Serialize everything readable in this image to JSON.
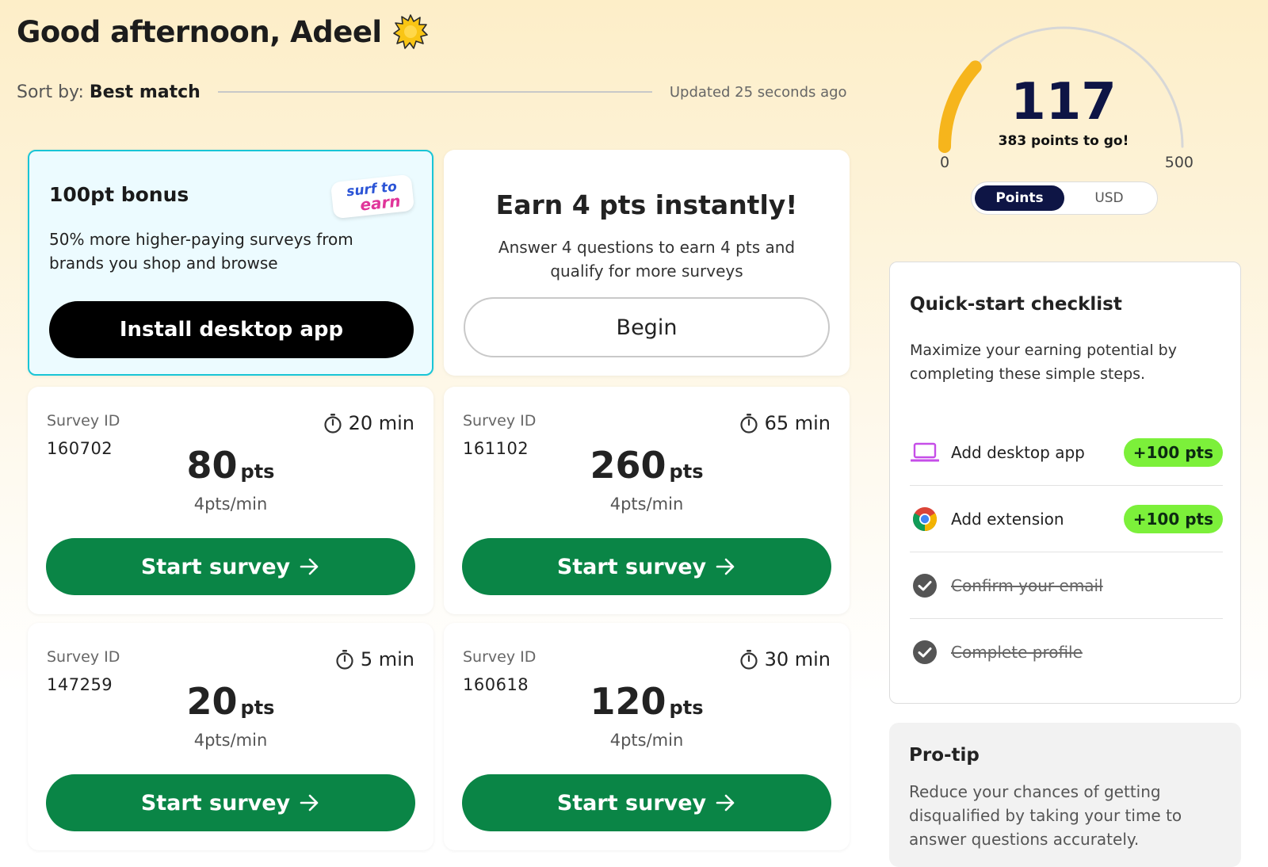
{
  "greeting": {
    "text": "Good afternoon, Adeel",
    "icon": "sun-icon"
  },
  "sort": {
    "label": "Sort by:",
    "value": "Best match",
    "updated": "Updated 25 seconds ago"
  },
  "bonus_card": {
    "title": "100pt bonus",
    "logo_line1": "surf to",
    "logo_line2": "earn",
    "description": "50% more higher-paying surveys from brands you shop and browse",
    "button": "Install desktop app"
  },
  "earn_card": {
    "title": "Earn 4 pts instantly!",
    "description": "Answer 4 questions to earn 4 pts and qualify for more surveys",
    "button": "Begin"
  },
  "surveys": [
    {
      "label": "Survey ID",
      "id": "160702",
      "time": "20 min",
      "points": "80",
      "unit": "pts",
      "rate": "4pts/min",
      "button": "Start survey"
    },
    {
      "label": "Survey ID",
      "id": "161102",
      "time": "65 min",
      "points": "260",
      "unit": "pts",
      "rate": "4pts/min",
      "button": "Start survey"
    },
    {
      "label": "Survey ID",
      "id": "147259",
      "time": "5 min",
      "points": "20",
      "unit": "pts",
      "rate": "4pts/min",
      "button": "Start survey"
    },
    {
      "label": "Survey ID",
      "id": "160618",
      "time": "30 min",
      "points": "120",
      "unit": "pts",
      "rate": "4pts/min",
      "button": "Start survey"
    }
  ],
  "gauge": {
    "value": "117",
    "value_num": 117,
    "min": "0",
    "max": "500",
    "subtitle": "383 points to go!",
    "fill_color": "#f6b51c"
  },
  "toggle": {
    "options": [
      "Points",
      "USD"
    ],
    "selected": "Points"
  },
  "checklist": {
    "title": "Quick-start checklist",
    "description": "Maximize your earning potential by completing these simple steps.",
    "items": [
      {
        "label": "Add desktop app",
        "badge": "+100 pts",
        "icon": "laptop-icon",
        "done": false
      },
      {
        "label": "Add extension",
        "badge": "+100 pts",
        "icon": "chrome-icon",
        "done": false
      },
      {
        "label": "Confirm your email",
        "icon": "check-circle-icon",
        "done": true
      },
      {
        "label": "Complete profile",
        "icon": "check-circle-icon",
        "done": true
      }
    ]
  },
  "protip": {
    "title": "Pro-tip",
    "text": "Reduce your chances of getting disqualified by taking your time to answer questions accurately."
  },
  "colors": {
    "accent_green": "#0a8546",
    "badge_green": "#7cf03a",
    "navy": "#0e1545",
    "bonus_border": "#19c5d6"
  }
}
